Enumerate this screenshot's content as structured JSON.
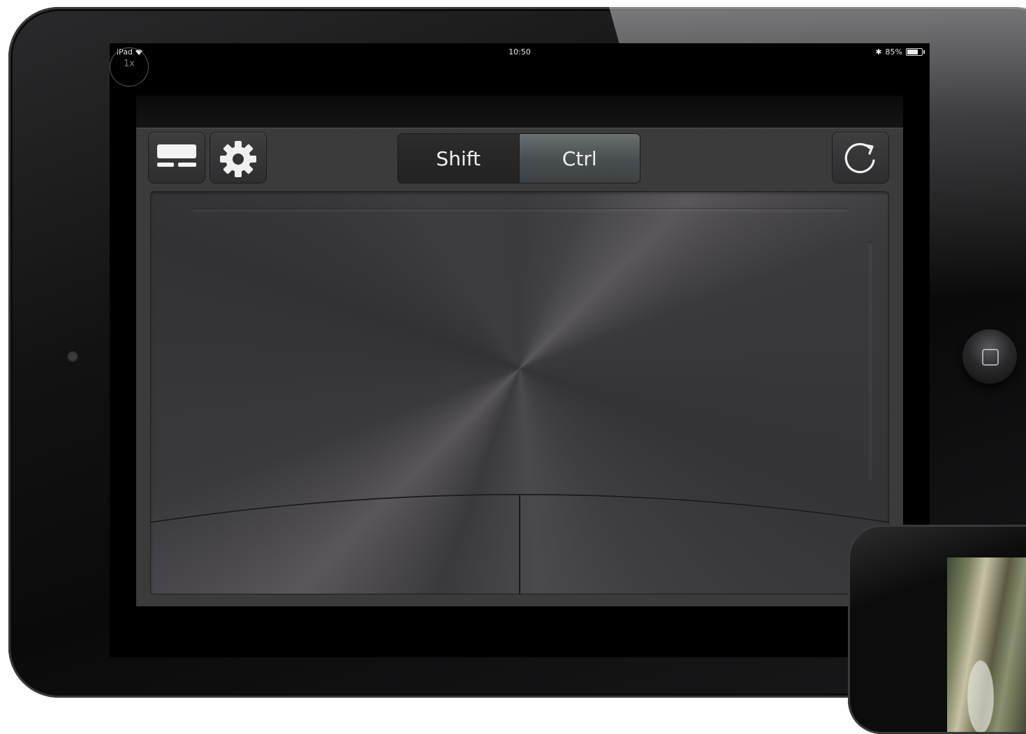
{
  "status_bar": {
    "device": "iPad",
    "time": "10:50",
    "battery": "85%",
    "battery_level": 0.85
  },
  "zoom_badge": "1x",
  "toolbar": {
    "keyboard_button": "keyboard-icon",
    "settings_button": "gear-icon",
    "refresh_button": "refresh-icon",
    "modifiers": {
      "shift_label": "Shift",
      "ctrl_label": "Ctrl",
      "active": "Ctrl"
    }
  },
  "trackpad": {
    "left_click_zone": "left-click",
    "right_click_zone": "right-click"
  },
  "colors": {
    "panel": "#3a3a3b",
    "active_segment": "#4a4f52",
    "text": "#f0f0f0"
  }
}
